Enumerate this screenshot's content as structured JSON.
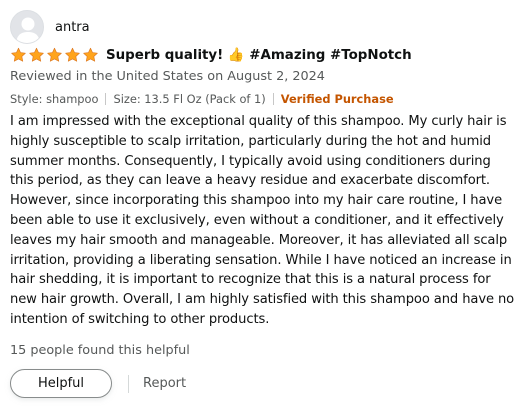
{
  "colors": {
    "star": "#ffa41c",
    "verified": "#c45500",
    "muted": "#565959",
    "text": "#0f1111"
  },
  "profile": {
    "avatar_icon": "user-silhouette-icon",
    "name": "antra"
  },
  "review": {
    "rating": 5,
    "rating_max": 5,
    "title": "Superb quality! 👍 #Amazing #TopNotch",
    "reviewed_in": "Reviewed in the United States on August 2, 2024",
    "style": "Style: shampoo",
    "size": "Size: 13.5 Fl Oz (Pack of 1)",
    "verified": "Verified Purchase",
    "body": "I am impressed with the exceptional quality of this shampoo. My curly hair is highly susceptible to scalp irritation, particularly during the hot and humid summer months. Consequently, I typically avoid using conditioners during this period, as they can leave a heavy residue and exacerbate discomfort. However, since incorporating this shampoo into my hair care routine, I have been able to use it exclusively, even without a conditioner, and it effectively leaves my hair smooth and manageable. Moreover, it has alleviated all scalp irritation, providing a liberating sensation. While I have noticed an increase in hair shedding, it is important to recognize that this is a natural process for new hair growth. Overall, I am highly satisfied with this shampoo and have no intention of switching to other products.",
    "helpful_count": "15 people found this helpful"
  },
  "actions": {
    "helpful_label": "Helpful",
    "report_label": "Report"
  }
}
